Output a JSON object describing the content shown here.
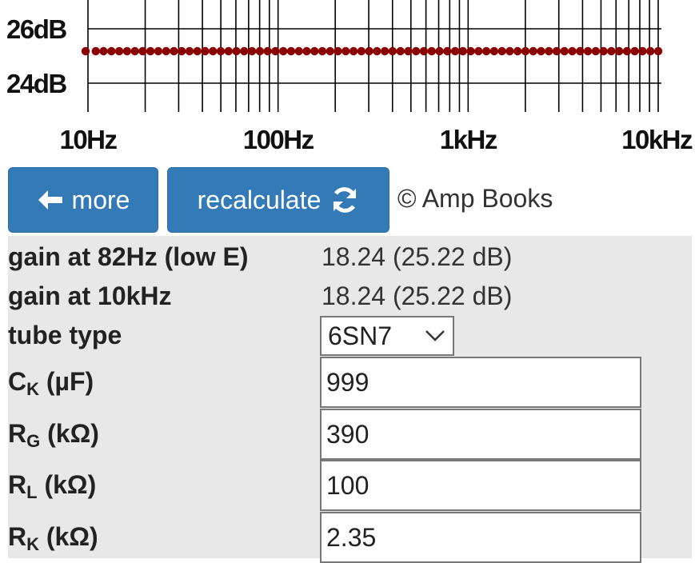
{
  "chart_data": {
    "type": "line",
    "x_scale": "log",
    "xlim": [
      10,
      10000
    ],
    "ylim": [
      23.5,
      26.5
    ],
    "x_tick_labels": [
      {
        "x": 10,
        "label": "10Hz"
      },
      {
        "x": 100,
        "label": "100Hz"
      },
      {
        "x": 1000,
        "label": "1kHz"
      },
      {
        "x": 10000,
        "label": "10kHz"
      }
    ],
    "y_tick_labels": [
      {
        "y": 26,
        "label": "26dB"
      },
      {
        "y": 24,
        "label": "24dB"
      }
    ],
    "series": [
      {
        "color": "#8b0000",
        "style": "dotted",
        "x_start": 10,
        "x_end": 10000,
        "y": 25.22
      }
    ],
    "grid": true
  },
  "buttons": {
    "more": "more",
    "recalculate": "recalculate"
  },
  "icons": {
    "more": "arrow-left-icon",
    "recalculate": "refresh-icon"
  },
  "copyright": "© Amp Books",
  "results": {
    "gain_low_label": "gain at 82Hz (low E)",
    "gain_low_value": "18.24 (25.22 dB)",
    "gain_high_label": "gain at 10kHz",
    "gain_high_value": "18.24 (25.22 dB)"
  },
  "fields": {
    "tube_type": {
      "label": "tube type",
      "value": "6SN7"
    },
    "ck": {
      "sym": "C",
      "sub": "K",
      "unit": " (µF)",
      "value": "999"
    },
    "rg": {
      "sym": "R",
      "sub": "G",
      "unit": " (kΩ)",
      "value": "390"
    },
    "rl": {
      "sym": "R",
      "sub": "L",
      "unit": " (kΩ)",
      "value": "100"
    },
    "rk": {
      "sym": "R",
      "sub": "K",
      "unit": " (kΩ)",
      "value": "2.35"
    }
  },
  "colors": {
    "button": "#337ab7",
    "panel": "#e8e8e8",
    "series": "#8b0000"
  }
}
